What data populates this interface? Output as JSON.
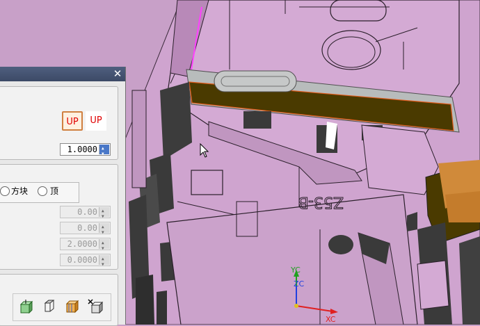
{
  "viewport": {
    "part_engraving": "Z53-B",
    "axes": {
      "yc": "YC",
      "zc": "ZC",
      "xc": "XC"
    },
    "colors": {
      "background": "#c8a0c8",
      "highlight": "#4a3a00",
      "outline": "#e05a1a"
    }
  },
  "dialog": {
    "close_icon": "close-icon",
    "up_buttons": [
      "UP",
      "UP"
    ],
    "scale_value": "1.0000",
    "radio_options": [
      "方块",
      "顶"
    ],
    "fields": [
      "0.00",
      "0.00",
      "2.0000",
      "0.0000"
    ],
    "tool_icons": [
      "block-icon",
      "extrude-icon",
      "boundary-block-icon",
      "delete-body-icon"
    ]
  }
}
